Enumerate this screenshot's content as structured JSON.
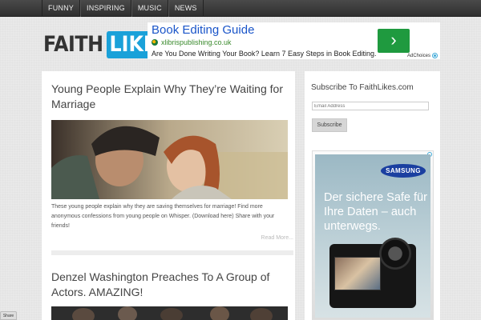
{
  "nav": {
    "items": [
      "FUNNY",
      "INSPIRING",
      "MUSIC",
      "NEWS"
    ]
  },
  "logo": {
    "part1": "FAITH",
    "part2": "LIKES"
  },
  "ad_top": {
    "title": "Book Editing Guide",
    "domain": "xlibrispublishing.co.uk",
    "description": "Are You Done Writing Your Book? Learn 7 Easy Steps in Book Editing.",
    "arrow": "›",
    "choices_label": "AdChoices"
  },
  "posts": [
    {
      "title": "Young People Explain Why They’re Waiting for Marriage",
      "excerpt": "These young people explain why they are saving themselves for marriage! Find more anonymous confessions from young people on Whisper. (Download here) Share with your friends!",
      "read_more": "Read More..."
    },
    {
      "title": "Denzel Washington Preaches To A Group of Actors. AMAZING!"
    }
  ],
  "sidebar": {
    "subscribe_title": "Subscribe To FaithLikes.com",
    "email_placeholder": "Email Address",
    "subscribe_button": "Subscribe",
    "ad_brand": "SAMSUNG",
    "ad_text": "Der sichere Safe für Ihre Daten – auch unterwegs."
  },
  "share": {
    "label": "Share"
  },
  "colors": {
    "nav_bg": "#3a3a3a",
    "brand_blue": "#1aa1d9",
    "ad_link": "#1a55c9",
    "ad_green": "#1f9a3f",
    "samsung_blue": "#1a3fa0"
  }
}
